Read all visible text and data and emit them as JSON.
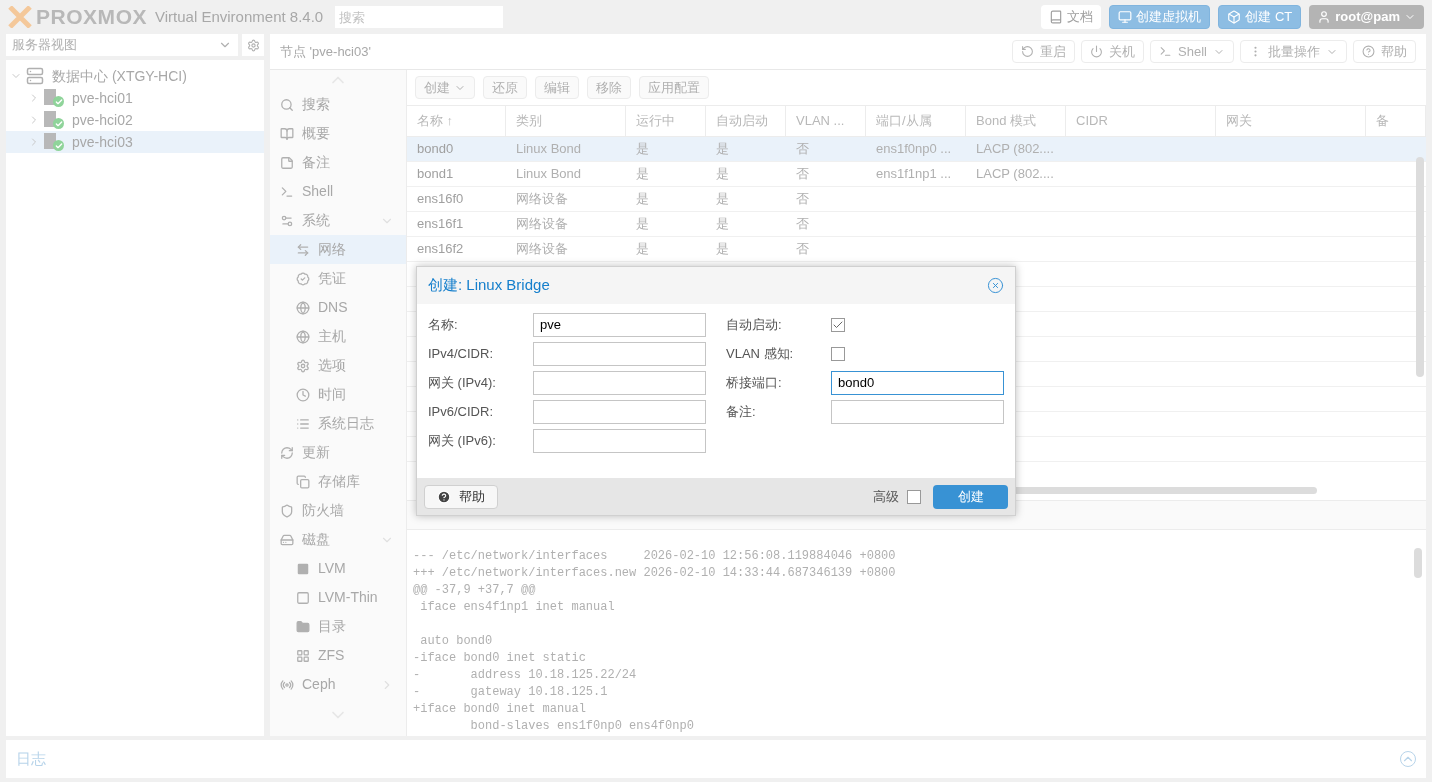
{
  "header": {
    "logo": "PROXMOX",
    "product": "Virtual Environment 8.4.0",
    "search": {
      "placeholder": "搜索"
    },
    "buttons": [
      {
        "label": "文档",
        "kind": "doc"
      },
      {
        "label": "创建虚拟机",
        "kind": "vm"
      },
      {
        "label": "创建 CT",
        "kind": "ct"
      },
      {
        "label": "root@pam",
        "kind": "user"
      }
    ]
  },
  "sidebar": {
    "view_select": "服务器视图",
    "tree": [
      {
        "label": "数据中心 (XTGY-HCI)",
        "kind": "datacenter",
        "expanded": true,
        "selected": false,
        "children": [
          {
            "label": "pve-hci01",
            "kind": "node",
            "online": true,
            "selected": false
          },
          {
            "label": "pve-hci02",
            "kind": "node",
            "online": true,
            "selected": false
          },
          {
            "label": "pve-hci03",
            "kind": "node",
            "online": true,
            "selected": true
          }
        ]
      }
    ]
  },
  "panel": {
    "title": "节点 'pve-hci03'",
    "tools": [
      {
        "label": "重启",
        "kind": "reboot"
      },
      {
        "label": "关机",
        "kind": "power"
      },
      {
        "label": "Shell",
        "kind": "shell"
      },
      {
        "label": "批量操作",
        "kind": "bulk"
      },
      {
        "label": "帮助",
        "kind": "help"
      }
    ],
    "nav": [
      {
        "label": "搜索",
        "kind": "search",
        "selected": false
      },
      {
        "label": "概要",
        "kind": "summary",
        "selected": false
      },
      {
        "label": "备注",
        "kind": "notes",
        "selected": false
      },
      {
        "label": "Shell",
        "kind": "shell",
        "selected": false
      },
      {
        "label": "系统",
        "kind": "system",
        "selected": false,
        "expanded": true,
        "children": [
          {
            "label": "网络",
            "kind": "network",
            "selected": true
          },
          {
            "label": "凭证",
            "kind": "certificates",
            "selected": false
          },
          {
            "label": "DNS",
            "kind": "dns",
            "selected": false
          },
          {
            "label": "主机",
            "kind": "hosts",
            "selected": false
          },
          {
            "label": "选项",
            "kind": "options",
            "selected": false
          },
          {
            "label": "时间",
            "kind": "time",
            "selected": false
          },
          {
            "label": "系统日志",
            "kind": "syslog",
            "selected": false
          }
        ]
      },
      {
        "label": "更新",
        "kind": "updates",
        "selected": false,
        "children": [
          {
            "label": "存储库",
            "kind": "repositories",
            "selected": false
          }
        ]
      },
      {
        "label": "防火墙",
        "kind": "firewall",
        "selected": false
      },
      {
        "label": "磁盘",
        "kind": "disks",
        "selected": false,
        "expanded": true,
        "children": [
          {
            "label": "LVM",
            "kind": "lvm",
            "selected": false
          },
          {
            "label": "LVM-Thin",
            "kind": "lvmthin",
            "selected": false
          },
          {
            "label": "目录",
            "kind": "directory",
            "selected": false
          },
          {
            "label": "ZFS",
            "kind": "zfs",
            "selected": false
          }
        ]
      },
      {
        "label": "Ceph",
        "kind": "ceph",
        "selected": false,
        "expanded": false
      }
    ],
    "toolbar": [
      {
        "label": "创建",
        "menu": true
      },
      {
        "label": "还原",
        "menu": false
      },
      {
        "label": "编辑",
        "menu": false
      },
      {
        "label": "移除",
        "menu": false
      },
      {
        "label": "应用配置",
        "menu": false
      }
    ],
    "table": {
      "columns": [
        "名称 ↑",
        "类别",
        "运行中",
        "自动启动",
        "VLAN ...",
        "端口/从属",
        "Bond 模式",
        "CIDR",
        "网关",
        "备"
      ],
      "rows": [
        {
          "selected": true,
          "cells": [
            "bond0",
            "Linux Bond",
            "是",
            "是",
            "否",
            "ens1f0np0 ...",
            "LACP (802....",
            "",
            ""
          ]
        },
        {
          "selected": false,
          "cells": [
            "bond1",
            "Linux Bond",
            "是",
            "是",
            "否",
            "ens1f1np1 ...",
            "LACP (802....",
            "",
            ""
          ]
        },
        {
          "selected": false,
          "cells": [
            "ens16f0",
            "网络设备",
            "是",
            "是",
            "否",
            "",
            "",
            "",
            ""
          ]
        },
        {
          "selected": false,
          "cells": [
            "ens16f1",
            "网络设备",
            "是",
            "是",
            "否",
            "",
            "",
            "",
            ""
          ]
        },
        {
          "selected": false,
          "cells": [
            "ens16f2",
            "网络设备",
            "是",
            "是",
            "否",
            "",
            "",
            "",
            ""
          ]
        }
      ]
    },
    "diff": [
      {
        "lines": [
          "--- /etc/network/interfaces     2026-02-10 12:56:08.119884046 +0800",
          "+++ /etc/network/interfaces.new 2026-02-10 14:33:44.687346139 +0800",
          "@@ -37,9 +37,7 @@",
          " iface ens4f1np1 inet manual"
        ]
      },
      {
        "lines": [
          " auto bond0",
          "-iface bond0 inet static",
          "-       address 10.18.125.22/24",
          "-       gateway 10.18.125.1",
          "+iface bond0 inet manual",
          "        bond-slaves ens1f0np0 ens4f0np0"
        ]
      }
    ]
  },
  "log_panel": {
    "title": "日志"
  },
  "dialog": {
    "title": "创建: Linux Bridge",
    "left": [
      {
        "label": "名称:",
        "kind": "text",
        "value": "pve",
        "focused": false
      },
      {
        "label": "IPv4/CIDR:",
        "kind": "text",
        "focused": false
      },
      {
        "label": "网关 (IPv4):",
        "kind": "text",
        "focused": false
      },
      {
        "label": "IPv6/CIDR:",
        "kind": "text",
        "focused": false
      },
      {
        "label": "网关 (IPv6):",
        "kind": "text",
        "focused": false
      }
    ],
    "right": [
      {
        "label": "自动启动:",
        "kind": "checkbox",
        "checked": true
      },
      {
        "label": "VLAN 感知:",
        "kind": "checkbox",
        "checked": false
      },
      {
        "label": "桥接端口:",
        "kind": "text",
        "value": "bond0",
        "focused": true
      },
      {
        "label": "备注:",
        "kind": "text",
        "focused": false
      }
    ],
    "help_button": "帮助",
    "advanced": {
      "label": "高级",
      "checked": false
    },
    "submit": "创建"
  }
}
